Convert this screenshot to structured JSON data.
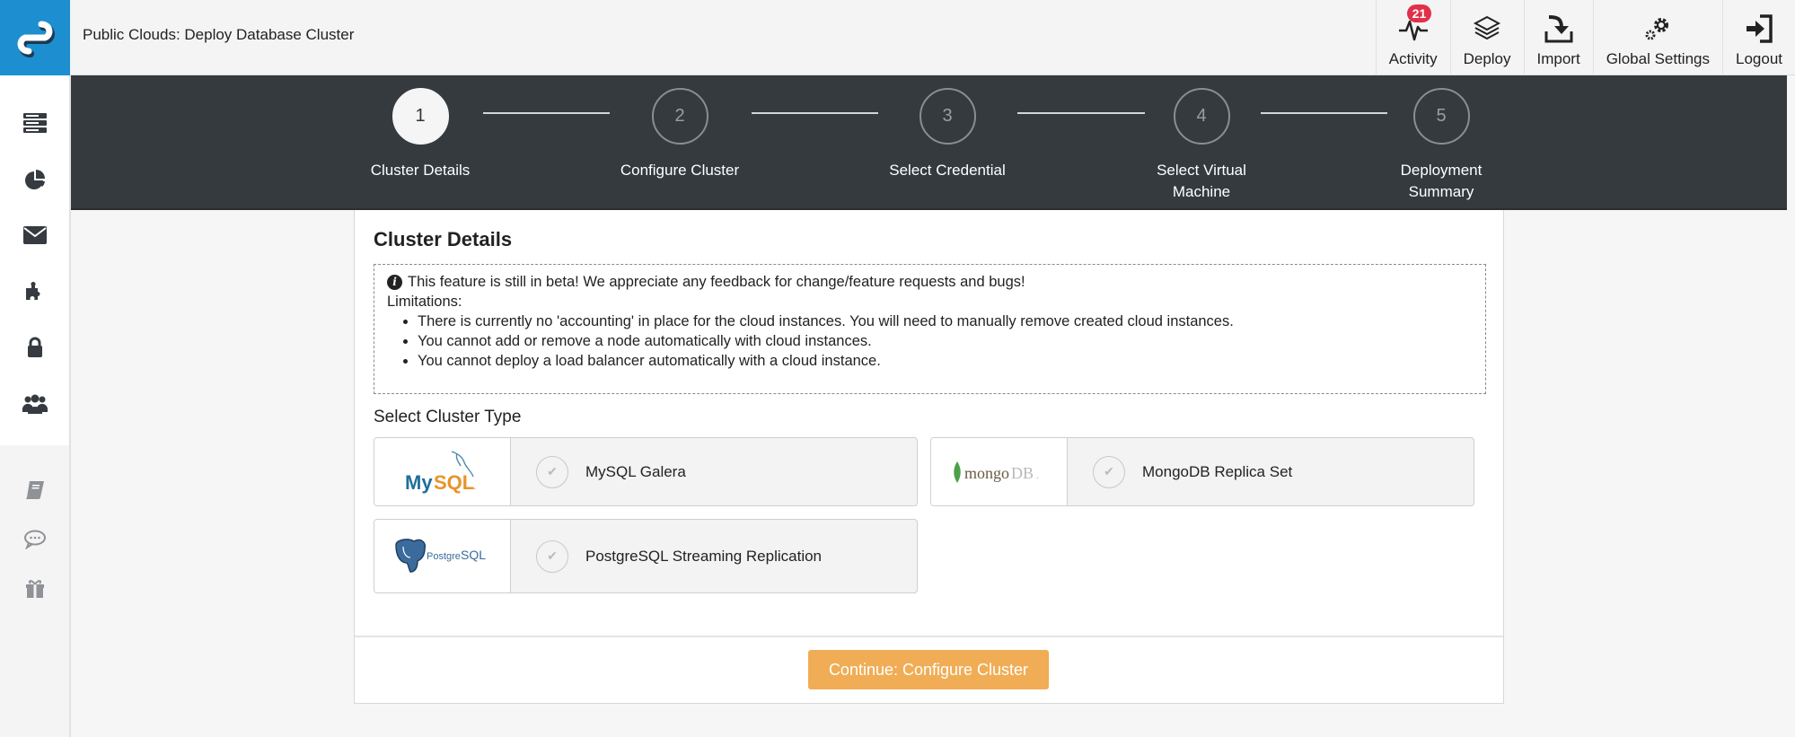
{
  "header": {
    "app_title": "Public Clouds: Deploy Database Cluster",
    "actions": [
      {
        "label": "Activity",
        "icon": "activity-pulse-icon",
        "badge": "21"
      },
      {
        "label": "Deploy",
        "icon": "layers-icon"
      },
      {
        "label": "Import",
        "icon": "import-icon"
      },
      {
        "label": "Global Settings",
        "icon": "gears-icon"
      },
      {
        "label": "Logout",
        "icon": "sign-in-icon"
      }
    ]
  },
  "sidebar": {
    "items": [
      {
        "icon": "server-list-icon"
      },
      {
        "icon": "pie-chart-icon"
      },
      {
        "icon": "envelope-icon"
      },
      {
        "icon": "puzzle-icon"
      },
      {
        "icon": "lock-icon"
      },
      {
        "icon": "users-icon"
      }
    ],
    "secondary_items": [
      {
        "icon": "book-icon"
      },
      {
        "icon": "chat-icon"
      },
      {
        "icon": "gift-icon"
      }
    ]
  },
  "wizard": {
    "current_step": 1,
    "steps": [
      {
        "number": "1",
        "label": "Cluster Details"
      },
      {
        "number": "2",
        "label": "Configure Cluster"
      },
      {
        "number": "3",
        "label": "Select Credential"
      },
      {
        "number": "4",
        "label": "Select Virtual Machine"
      },
      {
        "number": "5",
        "label": "Deployment Summary"
      }
    ]
  },
  "main": {
    "title": "Cluster Details",
    "info": {
      "message": "This feature is still in beta! We appreciate any feedback for change/feature requests and bugs!",
      "limitations_label": "Limitations:",
      "limitations": [
        "There is currently no 'accounting' in place for the cloud instances. You will need to manually remove created cloud instances.",
        "You cannot add or remove a node automatically with cloud instances.",
        "You cannot deploy a load balancer automatically with a cloud instance."
      ]
    },
    "section_label": "Select Cluster Type",
    "cluster_types": [
      {
        "name": "MySQL Galera",
        "logo": "MySQL",
        "selected": false
      },
      {
        "name": "MongoDB Replica Set",
        "logo": "mongoDB",
        "selected": false
      },
      {
        "name": "PostgreSQL Streaming Replication",
        "logo": "PostgreSQL",
        "selected": false
      }
    ],
    "continue_label": "Continue: Configure Cluster"
  },
  "colors": {
    "brand_blue": "#1d8ed0",
    "wizard_bg": "#343a3e",
    "continue_orange": "#f0ad55",
    "badge_red": "#e0304a"
  }
}
